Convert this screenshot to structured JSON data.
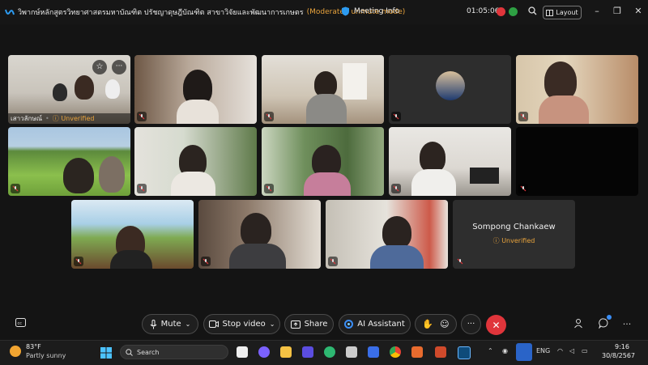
{
  "titlebar": {
    "title": "วิพากษ์หลักสูตรวิทยาศาสตรมหาบัณฑิต ปรัชญาดุษฎีบัณฑิต สาขาวิจัยและพัฒนาการเกษตร",
    "mode": "(Moderated unmute mode)",
    "meeting_info": "Meeting Info",
    "timer": "01:05:06",
    "layout": "Layout"
  },
  "participants": {
    "tile1_name": "เสาวลักษณ์",
    "tile1_status": "Unverified",
    "name_tile_name": "Sompong Chankaew",
    "name_tile_status": "Unverified"
  },
  "toolbar": {
    "mute": "Mute",
    "stop_video": "Stop video",
    "share": "Share",
    "ai_assistant": "AI Assistant"
  },
  "taskbar": {
    "temp": "83°F",
    "weather": "Partly sunny",
    "search_placeholder": "Search",
    "lang": "ENG",
    "time": "9:16",
    "date": "30/8/2567"
  },
  "colors": {
    "accent_orange": "#e8a33c",
    "end_call_red": "#e0353b",
    "background": "#141414"
  },
  "icons": [
    "webex-logo-icon",
    "shield-icon",
    "record-icon",
    "screen-share-status-icon",
    "search-icon",
    "layout-icon",
    "minimize-icon",
    "maximize-icon",
    "close-icon",
    "mic-muted-icon",
    "microphone-icon",
    "camera-icon",
    "share-icon",
    "ai-assistant-icon",
    "raise-hand-icon",
    "reactions-icon",
    "more-icon",
    "end-call-icon",
    "participants-icon",
    "chat-icon",
    "captions-icon",
    "windows-start-icon"
  ]
}
